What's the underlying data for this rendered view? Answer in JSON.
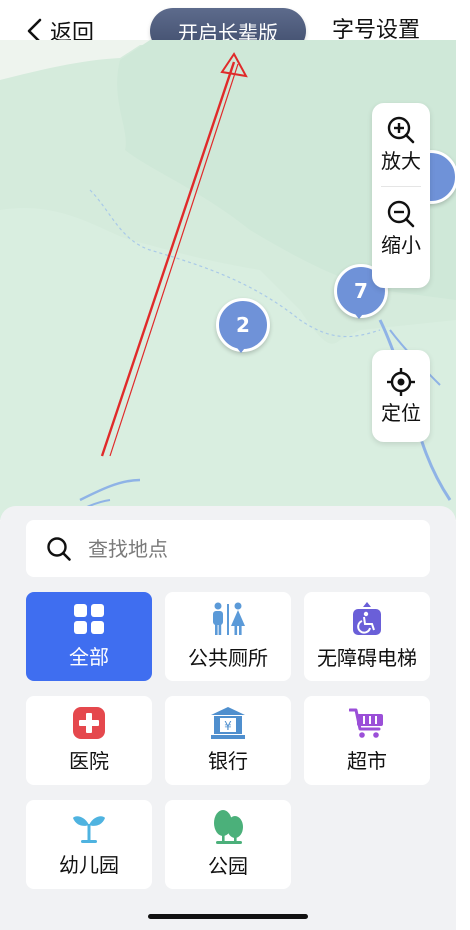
{
  "header": {
    "back_label": "返回",
    "elder_mode_label": "开启长辈版",
    "font_size_label": "字号设置"
  },
  "map": {
    "pins": [
      {
        "count": "2"
      },
      {
        "count": "7"
      }
    ],
    "controls": {
      "zoom_in_label": "放大",
      "zoom_out_label": "缩小",
      "locate_label": "定位"
    }
  },
  "search": {
    "placeholder": "查找地点"
  },
  "categories": [
    {
      "label": "全部",
      "icon": "grid-icon",
      "selected": true
    },
    {
      "label": "公共厕所",
      "icon": "restroom-icon",
      "selected": false
    },
    {
      "label": "无障碍电梯",
      "icon": "wheelchair-icon",
      "selected": false
    },
    {
      "label": "医院",
      "icon": "hospital-cross-icon",
      "selected": false
    },
    {
      "label": "银行",
      "icon": "bank-icon",
      "selected": false
    },
    {
      "label": "超市",
      "icon": "shopping-cart-icon",
      "selected": false
    },
    {
      "label": "幼儿园",
      "icon": "sprout-icon",
      "selected": false
    },
    {
      "label": "公园",
      "icon": "tree-icon",
      "selected": false
    }
  ],
  "colors": {
    "accent": "#3f6ef0",
    "pin": "#6f92d8",
    "elder_button": "#4b5877",
    "map_green": "#d3eadb",
    "map_light": "#eef4ee"
  }
}
